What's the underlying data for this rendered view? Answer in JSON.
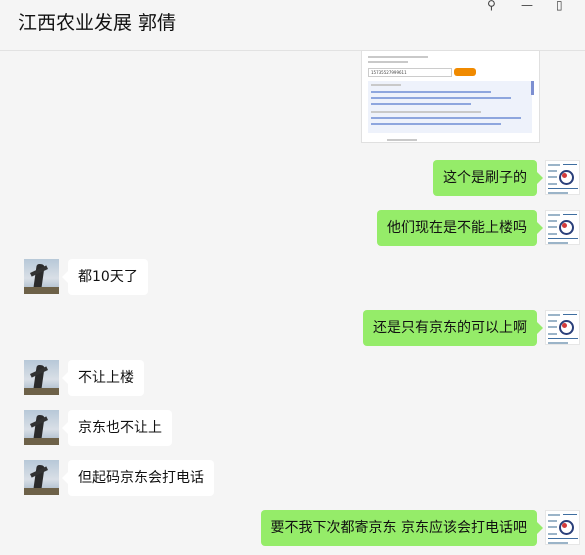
{
  "header": {
    "title": "江西农业发展 郭倩",
    "pin_icon": "pin-icon",
    "minimize_icon": "minimize-icon",
    "maximize_icon": "maximize-icon"
  },
  "thumbnail": {
    "input_value": "15735527999611"
  },
  "messages": [
    {
      "sender": "me",
      "text": "这个是刷子的"
    },
    {
      "sender": "me",
      "text": "他们现在是不能上楼吗"
    },
    {
      "sender": "them",
      "text": "都10天了"
    },
    {
      "sender": "me",
      "text": "还是只有京东的可以上啊"
    },
    {
      "sender": "them",
      "text": "不让上楼"
    },
    {
      "sender": "them",
      "text": "京东也不让上"
    },
    {
      "sender": "them",
      "text": "但起码京东会打电话"
    },
    {
      "sender": "me",
      "text": "要不我下次都寄京东 京东应该会打电话吧"
    }
  ],
  "colors": {
    "my_bubble": "#95ec69",
    "their_bubble": "#ffffff",
    "background": "#f5f5f5"
  }
}
